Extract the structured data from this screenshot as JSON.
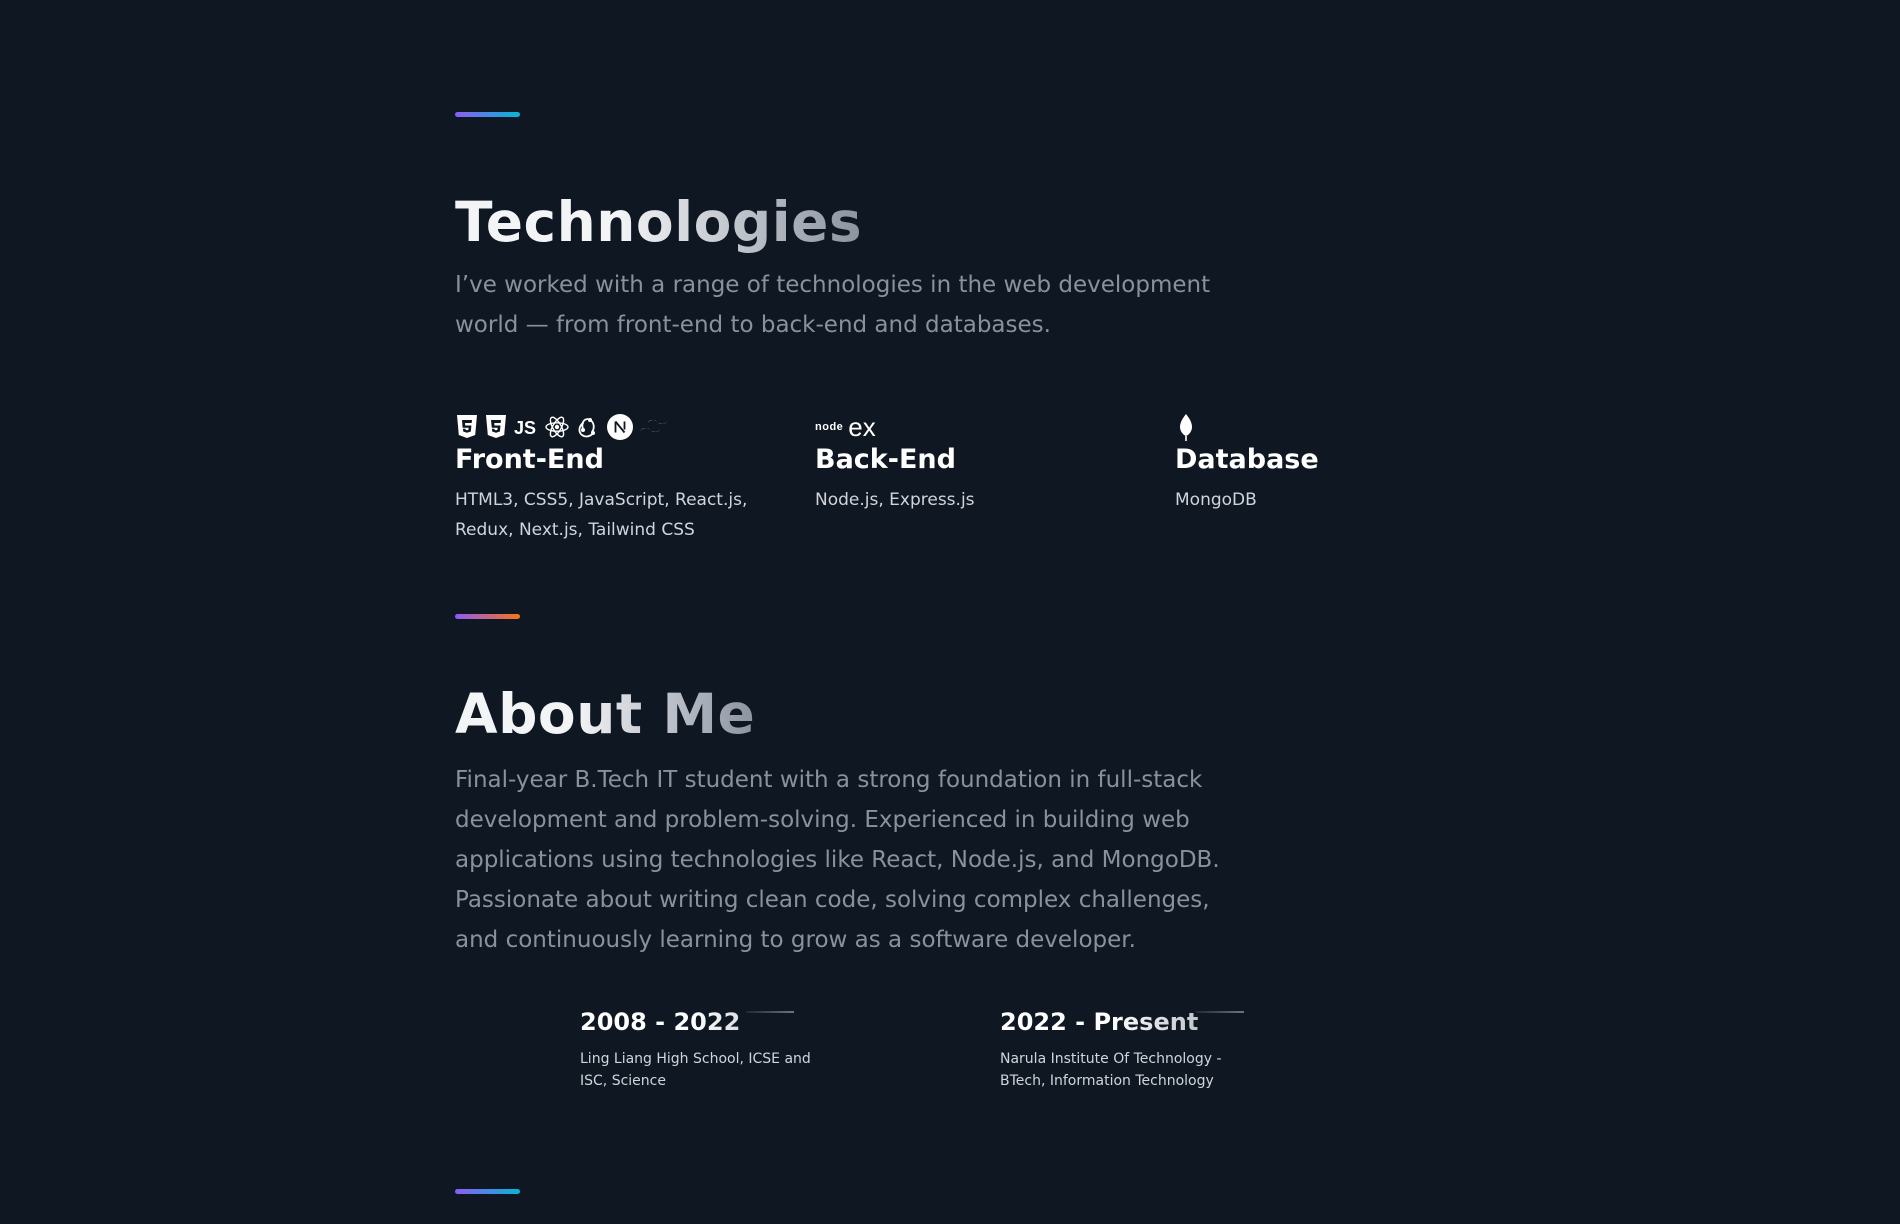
{
  "technologies": {
    "title": "Technologies",
    "description": "I’ve worked with a range of technologies in the web development world — from front-end to back-end and databases.",
    "categories": [
      {
        "name": "Front-End",
        "list": "HTML3, CSS5, JavaScript, React.js, Redux, Next.js, Tailwind CSS",
        "icons": [
          "html5-icon",
          "css3-icon",
          "javascript-icon",
          "react-icon",
          "redux-icon",
          "nextjs-icon",
          "tailwind-icon"
        ]
      },
      {
        "name": "Back-End",
        "list": "Node.js, Express.js",
        "icons": [
          "nodejs-icon",
          "express-icon"
        ],
        "icon_text": {
          "node": "node",
          "express": "ex"
        }
      },
      {
        "name": "Database",
        "list": "MongoDB",
        "icons": [
          "mongodb-icon"
        ]
      }
    ]
  },
  "about": {
    "title": "About Me",
    "description": "Final-year B.Tech IT student with a strong foundation in full-stack development and problem-solving. Experienced in building web applications using technologies like React, Node.js, and MongoDB. Passionate about writing clean code, solving complex challenges, and continuously learning to grow as a software developer.",
    "education": [
      {
        "years": "2008 - 2022",
        "details": "Ling Liang High School, ICSE and ISC, Science"
      },
      {
        "years": "2022 - Present",
        "details": "Narula Institute Of Technology - BTech, Information Technology"
      }
    ]
  },
  "colors": {
    "background": "#0f1723",
    "accent_gradient_1": [
      "#8b5cf6",
      "#06b6d4"
    ],
    "accent_gradient_2": [
      "#8b5cf6",
      "#f97316"
    ]
  }
}
